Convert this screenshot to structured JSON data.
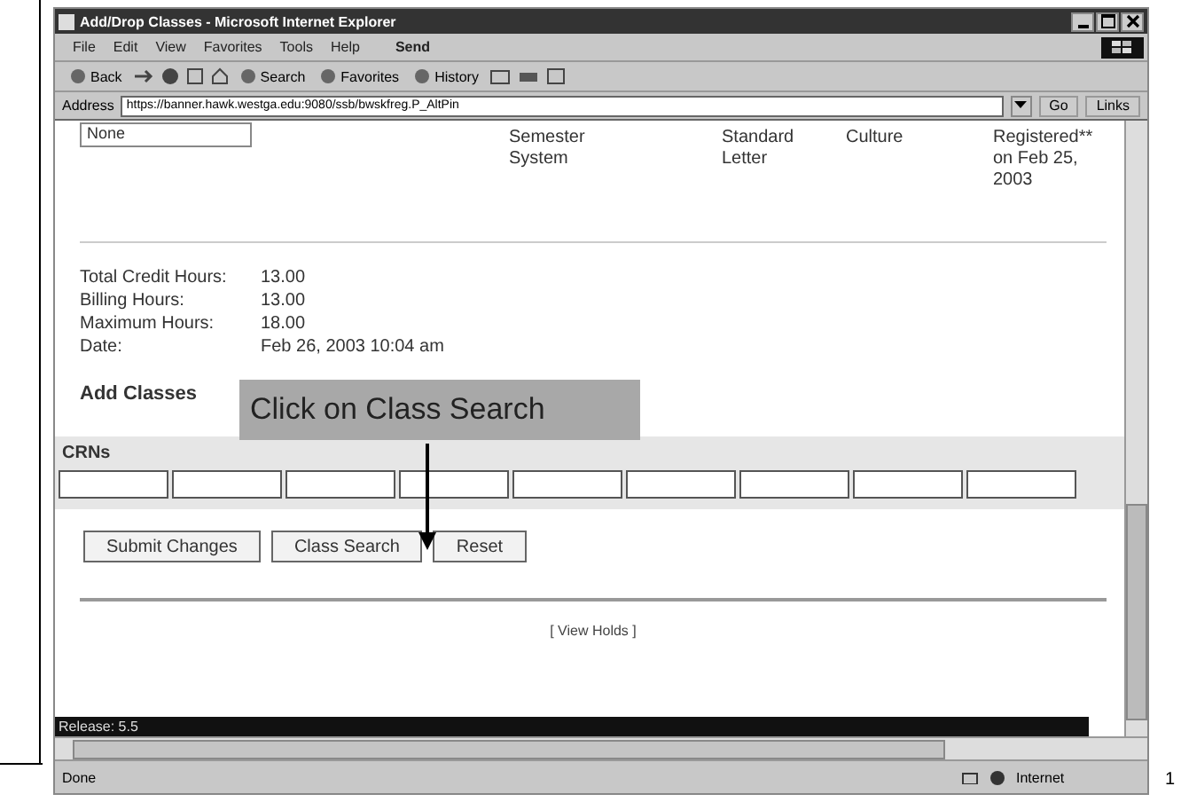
{
  "window": {
    "title": "Add/Drop Classes - Microsoft Internet Explorer"
  },
  "menu": [
    "File",
    "Edit",
    "View",
    "Favorites",
    "Tools",
    "Help",
    "Send"
  ],
  "toolbar": [
    "Back",
    "Search",
    "Favorites",
    "History"
  ],
  "address": {
    "label": "Address",
    "value": "https://banner.hawk.westga.edu:9080/ssb/bwskfreg.P_AltPin",
    "go": "Go",
    "links": "Links"
  },
  "prev_row": {
    "select": "None",
    "cells": [
      "Semester System",
      "Standard Letter",
      "Culture",
      "Registered** on Feb 25, 2003"
    ]
  },
  "summary": [
    {
      "label": "Total Credit Hours:",
      "value": "13.00"
    },
    {
      "label": "Billing Hours:",
      "value": "13.00"
    },
    {
      "label": "Maximum Hours:",
      "value": "18.00"
    },
    {
      "label": "Date:",
      "value": "Feb 26, 2003 10:04 am"
    }
  ],
  "add_classes": {
    "heading": "Add Classes",
    "crns_label": "CRNs"
  },
  "callout": "Click on Class Search",
  "buttons": [
    "Submit Changes",
    "Class Search",
    "Reset"
  ],
  "link": "[ View Holds ]",
  "release": "Release: 5.5",
  "status_bar": {
    "text": "Done",
    "zone": "Internet"
  },
  "page_number": "1"
}
